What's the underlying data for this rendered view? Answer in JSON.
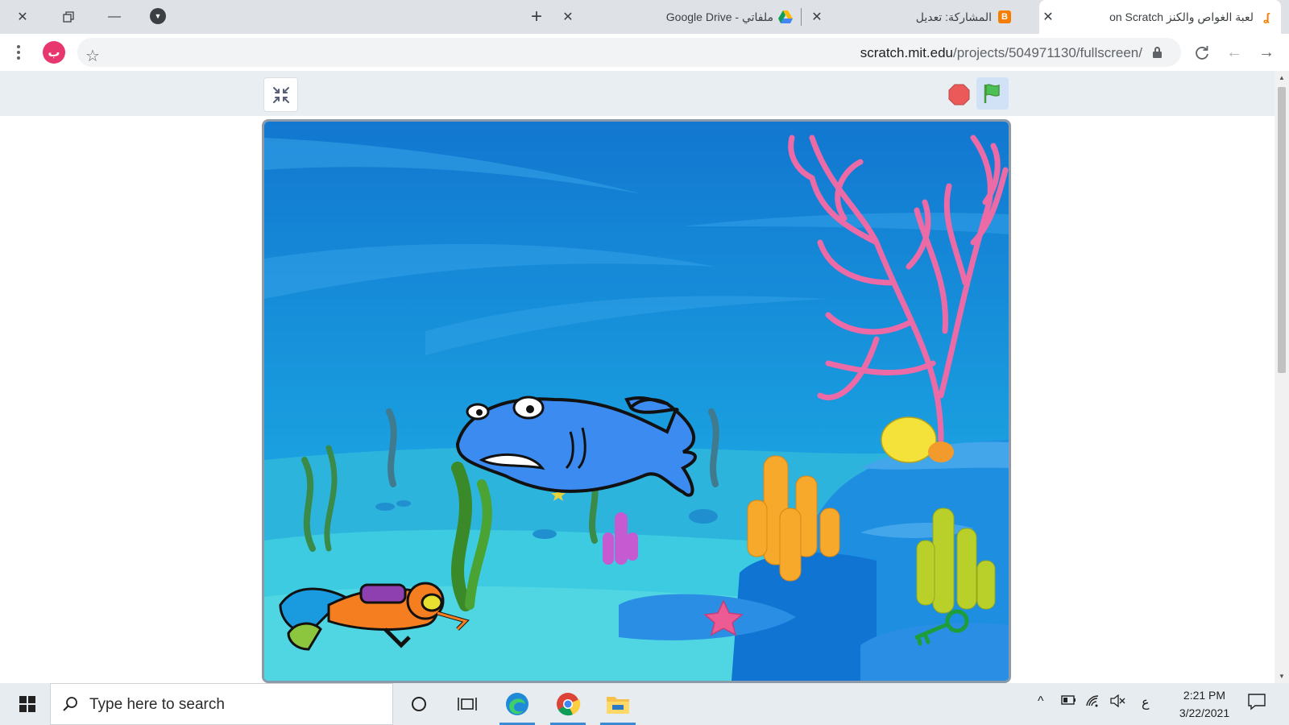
{
  "browser": {
    "tabs": [
      {
        "title": "لعبة الغواص والكنز on Scratch",
        "active": true,
        "favicon": "blogger-orange"
      },
      {
        "title": "المشاركة: تعديل",
        "active": false,
        "favicon": "blogger-icon"
      },
      {
        "title": "ملفاتي - Google Drive",
        "active": false,
        "favicon": "google-drive-icon"
      }
    ],
    "url_domain": "scratch.mit.edu",
    "url_path": "/projects/504971130/fullscreen/",
    "profile_initial": "ب"
  },
  "scratch": {
    "controls": [
      "unfullscreen-button",
      "stop-button",
      "green-flag-button"
    ],
    "stage_sprites": [
      "shark",
      "diver",
      "key",
      "starfish",
      "coral"
    ]
  },
  "taskbar": {
    "search_placeholder": "Type here to search",
    "language": "ع",
    "time": "2:21 PM",
    "date": "3/22/2021"
  },
  "colors": {
    "tabstrip": "#dee1e6",
    "stage_water": "#1a8fd6",
    "flag_green": "#4cbf56",
    "stop_red": "#ec5959"
  }
}
